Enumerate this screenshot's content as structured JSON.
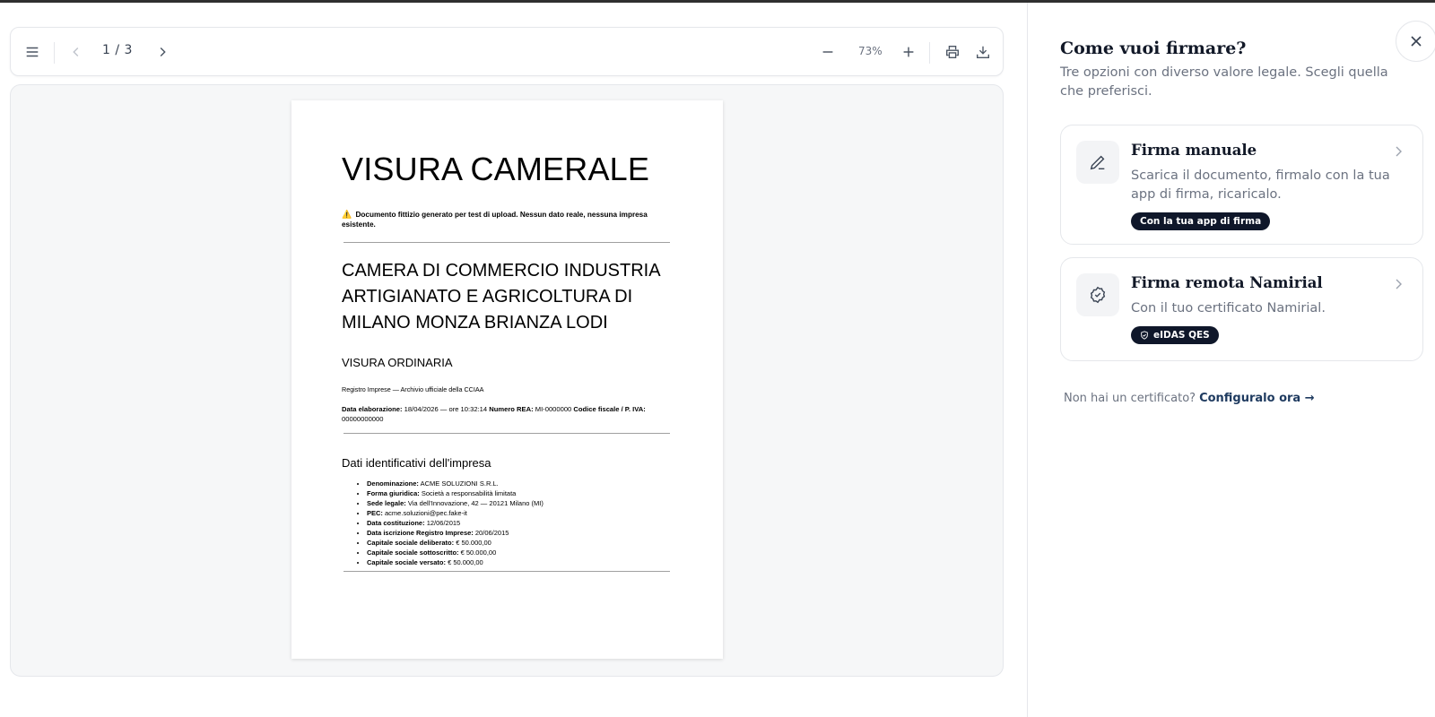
{
  "viewer": {
    "page_indicator": "1 / 3",
    "zoom": "73%",
    "icons": {
      "menu": "menu-icon",
      "prev": "chevron-left-icon",
      "next": "chevron-right-icon",
      "zoom_out": "minus-icon",
      "zoom_in": "plus-icon",
      "print": "printer-icon",
      "download": "download-icon"
    }
  },
  "document": {
    "title": "VISURA CAMERALE",
    "warning_icon": "⚠️",
    "warning": "Documento fittizio generato per test di upload. Nessun dato reale, nessuna impresa esistente.",
    "chamber": "CAMERA DI COMMERCIO INDUSTRIA ARTIGIANATO E AGRICOLTURA DI MILANO MONZA BRIANZA LODI",
    "visura_type": "VISURA ORDINARIA",
    "registry": "Registro Imprese — Archivio ufficiale della CCIAA",
    "meta": {
      "elab_label": "Data elaborazione:",
      "elab_value": "18/04/2026 — ore 10:32:14",
      "rea_label": "Numero REA:",
      "rea_value": "MI-0000000",
      "cf_label": "Codice fiscale / P. IVA:",
      "cf_value": "00000000000"
    },
    "section_title": "Dati identificativi dell'impresa",
    "items": [
      {
        "label": "Denominazione:",
        "value": "ACME SOLUZIONI S.R.L."
      },
      {
        "label": "Forma giuridica:",
        "value": "Società a responsabilità limitata"
      },
      {
        "label": "Sede legale:",
        "value": "Via dell'Innovazione, 42 — 20121 Milano (MI)"
      },
      {
        "label": "PEC:",
        "value": "acme.soluzioni@pec.fake-it"
      },
      {
        "label": "Data costituzione:",
        "value": "12/06/2015"
      },
      {
        "label": "Data iscrizione Registro Imprese:",
        "value": "20/06/2015"
      },
      {
        "label": "Capitale sociale deliberato:",
        "value": "€ 50.000,00"
      },
      {
        "label": "Capitale sociale sottoscritto:",
        "value": "€ 50.000,00"
      },
      {
        "label": "Capitale sociale versato:",
        "value": "€ 50.000,00"
      }
    ]
  },
  "panel": {
    "title": "Come vuoi firmare?",
    "subtitle": "Tre opzioni con diverso valore legale. Scegli quella che preferisci.",
    "close_icon": "close-icon",
    "options": [
      {
        "title": "Firma manuale",
        "description": "Scarica il documento, firmalo con la tua app di firma, ricaricalo.",
        "badge": "Con la tua app di firma",
        "icon": "pen-icon"
      },
      {
        "title": "Firma remota Namirial",
        "description": "Con il tuo certificato Namirial.",
        "badge": "eIDAS QES",
        "icon": "badge-check-icon",
        "badge_icon": "shield-icon"
      }
    ],
    "no_cert_text": "Non hai un certificato?",
    "no_cert_link": "Configuralo ora →"
  }
}
